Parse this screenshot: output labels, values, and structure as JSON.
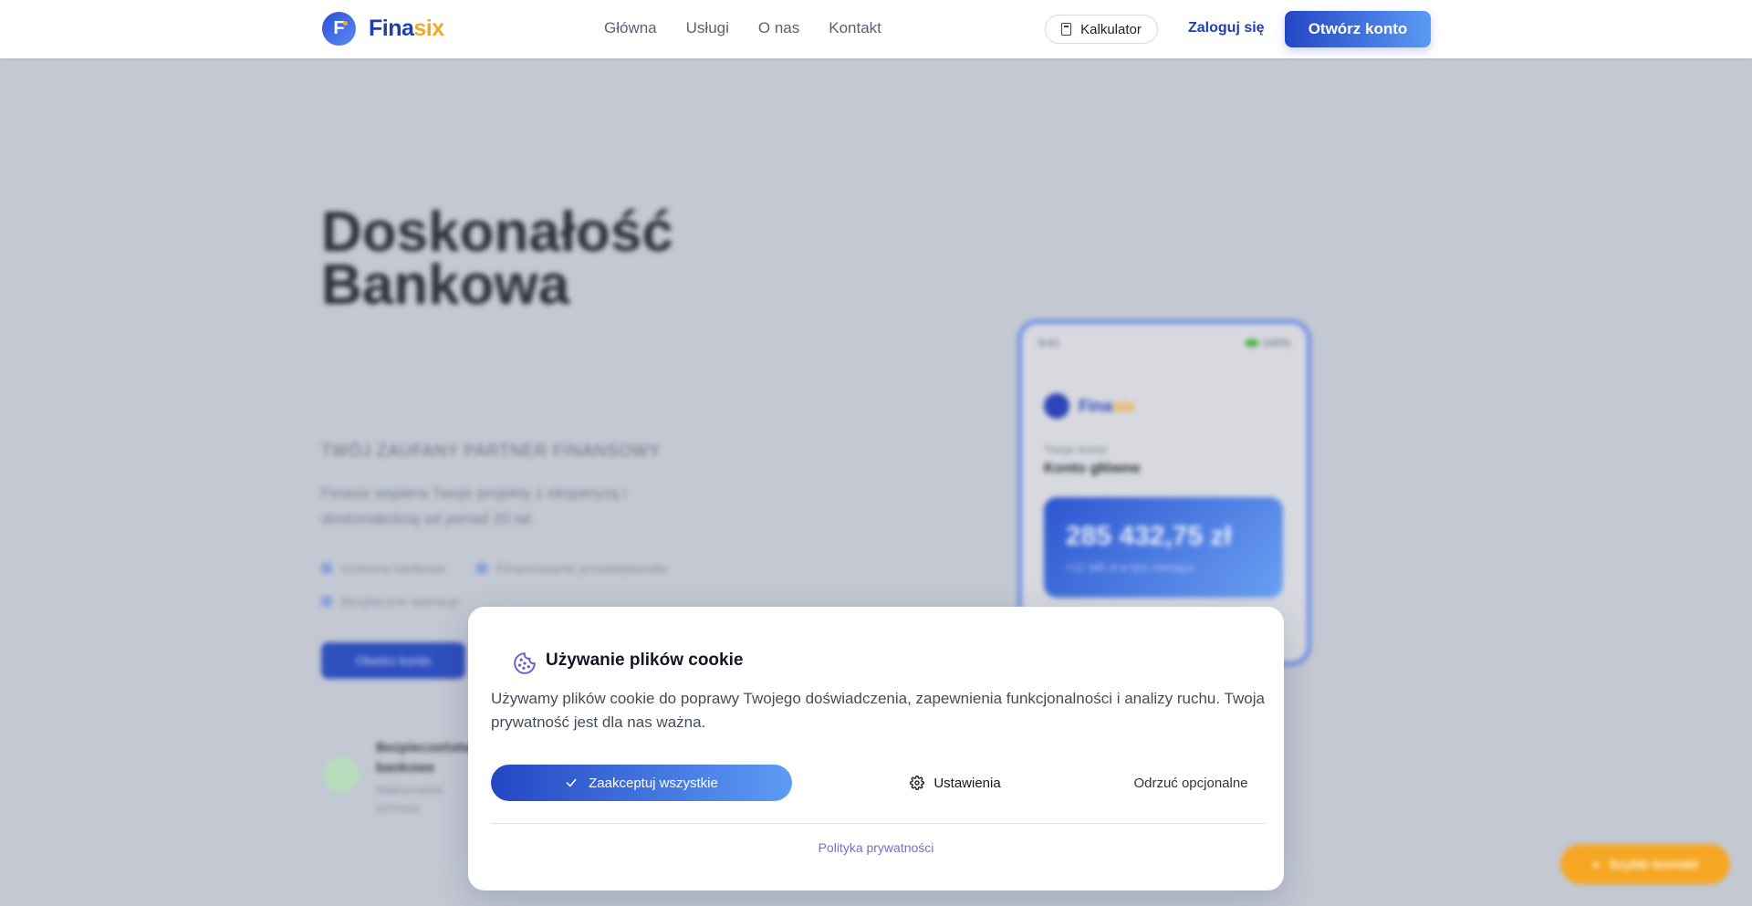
{
  "header": {
    "logo": {
      "part1": "Fina",
      "part2": "six",
      "mark": "F"
    },
    "nav": [
      "Główna",
      "Usługi",
      "O nas",
      "Kontakt"
    ],
    "calculator_label": "Kalkulator",
    "login_label": "Zaloguj się",
    "open_account_label": "Otwórz konto"
  },
  "hero": {
    "title_line1": "Doskonałość",
    "title_line2": "Bankowa",
    "subtitle": "Twój zaufany partner finansowy",
    "description": "Finasix wspiera Twoje projekty z eksperyzą i doskonałością od ponad 20 lat.",
    "features": [
      "Ochrona bankowa",
      "Finansowanie przedsiębiorstw",
      "Bezpieczne operacje"
    ],
    "cta_label": "Otwórz konto",
    "badge_title": "Bezpieczeństwo bankowe",
    "badge_sub": "Maksymalna ochrona",
    "phone": {
      "time": "9:41",
      "battery": "100%",
      "logo_part1": "Fina",
      "logo_part2": "six",
      "account_label": "Twoje konto",
      "account_name": "Konto główne",
      "balance": "285 432,75 zł",
      "balance_sub": "+12 345 zł w tym miesiącu"
    },
    "chat_label": "Szybki kontakt"
  },
  "cookie": {
    "title": "Używanie plików cookie",
    "text": "Używamy plików cookie do poprawy Twojego doświadczenia, zapewnienia funkcjonalności i analizy ruchu. Twoja prywatność jest dla nas ważna.",
    "accept_label": "Zaakceptuj wszystkie",
    "settings_label": "Ustawienia",
    "reject_label": "Odrzuć opcjonalne",
    "privacy_label": "Polityka prywatności"
  },
  "colors": {
    "brand_blue": "#1f3fb0",
    "brand_orange": "#f5a623",
    "link_purple": "#7c6ac9"
  }
}
